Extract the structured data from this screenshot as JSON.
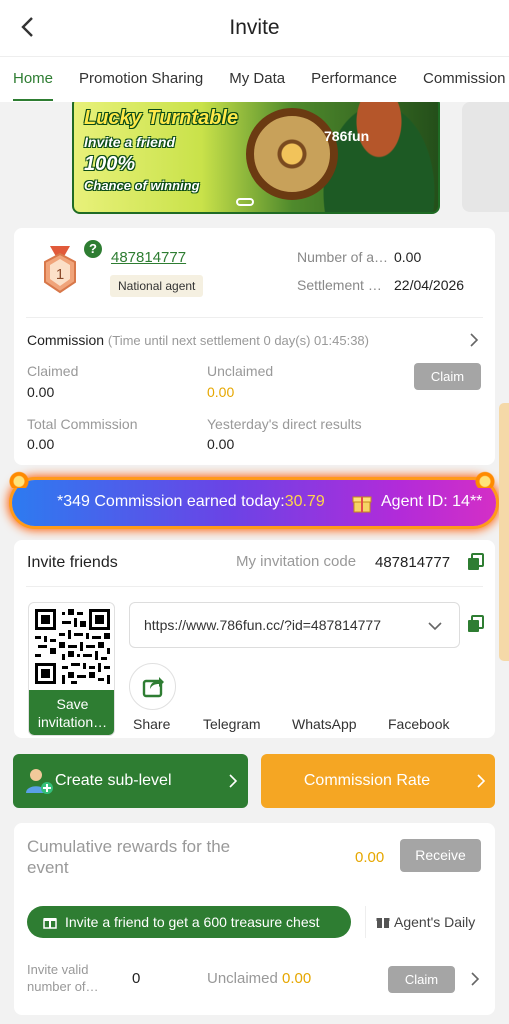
{
  "header": {
    "title": "Invite"
  },
  "tabs": [
    "Home",
    "Promotion Sharing",
    "My Data",
    "Performance",
    "Commission"
  ],
  "banner": {
    "line1": "Lucky Turntable",
    "line2": "Invite a friend",
    "line3": "100%",
    "line4": "Chance of winning",
    "logo": "786fun"
  },
  "agent": {
    "rank": "1",
    "uid": "487814777",
    "badge": "National agent",
    "info": [
      {
        "label": "Number of a…",
        "value": "0.00"
      },
      {
        "label": "Settlement …",
        "value": "22/04/2026"
      }
    ]
  },
  "commission": {
    "title": "Commission",
    "subtitle": "(Time until next settlement 0 day(s) 01:45:38)",
    "claimed_label": "Claimed",
    "claimed_value": "0.00",
    "unclaimed_label": "Unclaimed",
    "unclaimed_value": "0.00",
    "claim_btn": "Claim",
    "total_label": "Total Commission",
    "total_value": "0.00",
    "yesterday_label": "Yesterday's direct results",
    "yesterday_value": "0.00"
  },
  "ticker": {
    "prefix": "*349 Commission earned today:",
    "amount": "30.79",
    "agent_id": "Agent ID: 14**"
  },
  "invite": {
    "title": "Invite friends",
    "code_label": "My invitation code",
    "code_value": "487814777",
    "save_btn_1": "Save",
    "save_btn_2": "invitation…",
    "url": "https://www.786fun.cc/?id=487814777",
    "share_labels": [
      "Share",
      "Telegram",
      "WhatsApp",
      "Facebook"
    ]
  },
  "actions": {
    "sub_level": "Create sub-level",
    "commission_rate": "Commission Rate"
  },
  "event": {
    "title": "Cumulative rewards for the event",
    "value": "0.00",
    "receive_btn": "Receive",
    "pill": "Invite a friend to get a 600 treasure chest",
    "daily": "Agent's Daily",
    "valid_label": "Invite valid number of…",
    "valid_count": "0",
    "unclaimed_label": "Unclaimed",
    "unclaimed_value": "0.00",
    "claim_btn": "Claim"
  },
  "colors": {
    "green": "#2e7d32",
    "gold": "#e6a700",
    "orange": "#f5a623"
  }
}
